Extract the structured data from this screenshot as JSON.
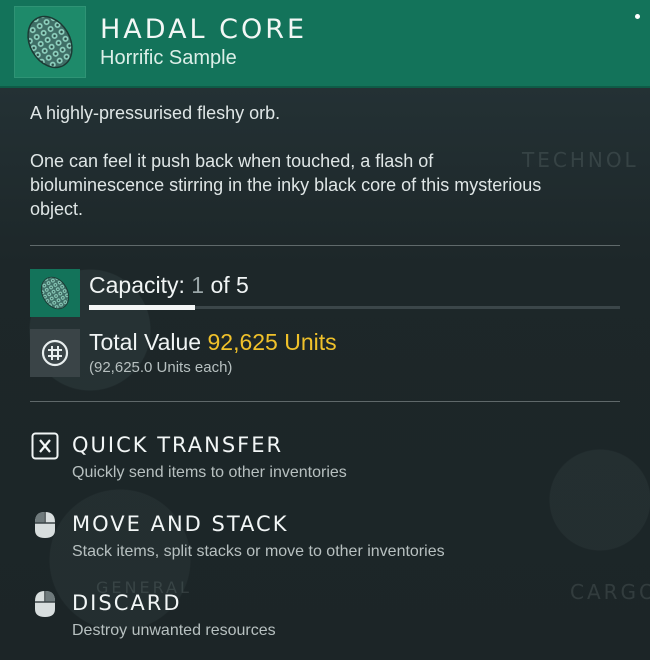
{
  "item": {
    "title": "HADAL CORE",
    "subtitle": "Horrific Sample",
    "icon": "hadal-core-orb-icon",
    "description": [
      "A highly-pressurised fleshy orb.",
      "One can feel it push back when touched, a flash of bioluminescence stirring in the inky black core of this mysterious object."
    ]
  },
  "capacity": {
    "label": "Capacity:",
    "current": "1",
    "of_text": "of 5",
    "fill_fraction": 0.2
  },
  "value": {
    "label": "Total Value",
    "amount": "92,625 Units",
    "each": "(92,625.0 Units each)",
    "icon": "units-currency-icon",
    "amount_color": "#f0c12a"
  },
  "actions": [
    {
      "key_icon": "x-key-icon",
      "label": "QUICK TRANSFER",
      "hint": "Quickly send items to other inventories"
    },
    {
      "key_icon": "mouse-left-icon",
      "label": "MOVE AND STACK",
      "hint": "Stack items, split stacks or move to other inventories"
    },
    {
      "key_icon": "mouse-right-icon",
      "label": "DISCARD",
      "hint": "Destroy unwanted resources"
    }
  ],
  "background_labels": [
    "TECHNOL",
    "CARGO",
    "GENERAL"
  ],
  "colors": {
    "header": "#13735a",
    "accent_gold": "#f0c12a",
    "panel": "#1f2a2d"
  }
}
